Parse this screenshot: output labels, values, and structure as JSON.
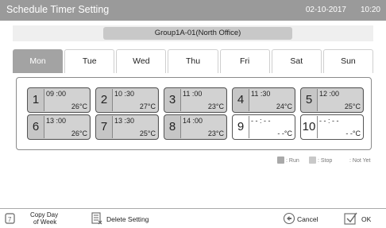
{
  "header": {
    "title": "Schedule Timer Setting",
    "date": "02-10-2017",
    "time": "10:20"
  },
  "group": {
    "name": "Group1A-01(North Office)"
  },
  "tabs": [
    {
      "label": "Mon",
      "active": true
    },
    {
      "label": "Tue",
      "active": false
    },
    {
      "label": "Wed",
      "active": false
    },
    {
      "label": "Thu",
      "active": false
    },
    {
      "label": "Fri",
      "active": false
    },
    {
      "label": "Sat",
      "active": false
    },
    {
      "label": "Sun",
      "active": false
    }
  ],
  "slots": [
    {
      "num": "1",
      "time": "09 :00",
      "temp": "26°C",
      "state": "set"
    },
    {
      "num": "2",
      "time": "10 :30",
      "temp": "27°C",
      "state": "set"
    },
    {
      "num": "3",
      "time": "11 :00",
      "temp": "23°C",
      "state": "set"
    },
    {
      "num": "4",
      "time": "11 :30",
      "temp": "24°C",
      "state": "set"
    },
    {
      "num": "5",
      "time": "12 :00",
      "temp": "25°C",
      "state": "set"
    },
    {
      "num": "6",
      "time": "13 :00",
      "temp": "26°C",
      "state": "set"
    },
    {
      "num": "7",
      "time": "13 :30",
      "temp": "25°C",
      "state": "set"
    },
    {
      "num": "8",
      "time": "14 :00",
      "temp": "23°C",
      "state": "set"
    },
    {
      "num": "9",
      "time": "- - : - -",
      "temp": "- -°C",
      "state": "notyet"
    },
    {
      "num": "10",
      "time": "- - : - -",
      "temp": "- -°C",
      "state": "notyet"
    }
  ],
  "legend": {
    "run": ": Run",
    "stop": ": Stop",
    "notyet": ": Not Yet",
    "colors": {
      "run": "#a9a9a9",
      "stop": "#c8c8c8",
      "notyet": "#ffffff"
    }
  },
  "footer": {
    "copy_line1": "Copy Day",
    "copy_line2": "of Week",
    "delete": "Delete Setting",
    "cancel": "Cancel",
    "ok": "OK"
  },
  "colors": {
    "titlebar": "#9a9a9a",
    "active_tab": "#a3a3a3",
    "slot_fill": "#c6c6c6"
  }
}
